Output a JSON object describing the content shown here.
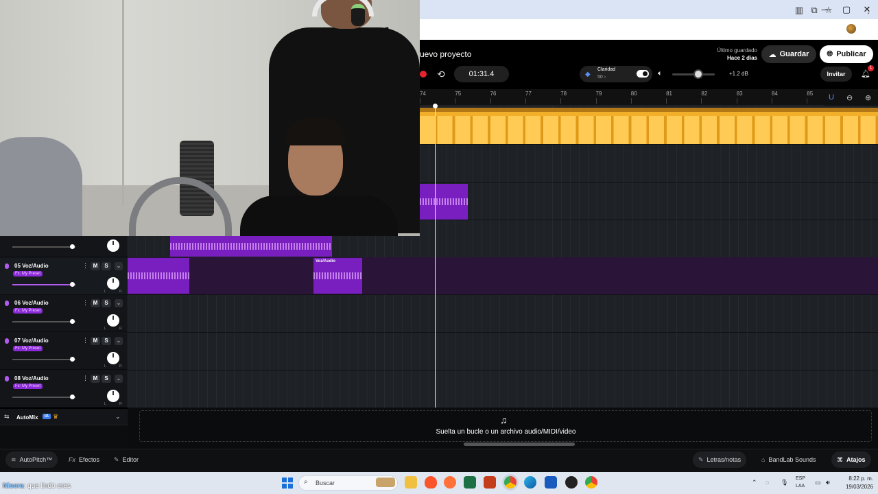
{
  "browser": {
    "window_controls": {
      "minimize": "—",
      "maximize": "▢",
      "close": "✕"
    },
    "toolbar_icons": [
      "sidebar-icon",
      "install-icon",
      "star-icon",
      "profile-avatar",
      "kebab-menu-icon"
    ]
  },
  "header": {
    "project_title": "uevo proyecto",
    "last_saved_label": "Último guardado",
    "last_saved_value": "Hace 2 días",
    "save_label": "Guardar",
    "publish_label": "Publicar"
  },
  "transport": {
    "time": "01:31.4",
    "clarity_label": "Claridad",
    "clarity_value": "50 ›",
    "clarity_enabled": true,
    "volume_level": 0.62,
    "gain": "+1.2 dB",
    "invite_label": "Invitar",
    "notifications_count": "1"
  },
  "ruler": {
    "bars": [
      "74",
      "75",
      "76",
      "77",
      "78",
      "79",
      "80",
      "81",
      "82",
      "83",
      "84",
      "85"
    ]
  },
  "tracks": [
    {
      "name": "05 Voz/Audio",
      "fx": "Fx: My Preset",
      "mute": "M",
      "solo": "S",
      "pan_l": "L",
      "pan_r": "R"
    },
    {
      "name": "06 Voz/Audio",
      "fx": "Fx: My Preset",
      "mute": "M",
      "solo": "S",
      "pan_l": "L",
      "pan_r": "R"
    },
    {
      "name": "07 Voz/Audio",
      "fx": "Fx: My Preset",
      "mute": "M",
      "solo": "S",
      "pan_l": "L",
      "pan_r": "R"
    },
    {
      "name": "08 Voz/Audio",
      "fx": "Fx: My Preset",
      "mute": "M",
      "solo": "S",
      "pan_l": "L",
      "pan_r": "R"
    }
  ],
  "clips": {
    "voz_audio_label": "Voz/Audio"
  },
  "automix": {
    "label": "AutoMix",
    "badge": "IA"
  },
  "drop_zone": {
    "text": "Suelta un bucle o un archivo audio/MIDI/video"
  },
  "bottom_toolbar": {
    "autopitch": "AutoPitch™",
    "effects": "Efectos",
    "editor": "Editor",
    "lyrics": "Letras/notas",
    "sounds": "BandLab Sounds",
    "shortcuts": "Atajos"
  },
  "overlay_chat": {
    "user": "Nisera",
    "message": ": que lindo eres"
  },
  "taskbar": {
    "search_placeholder": "Buscar",
    "language_top": "ESP",
    "language_bottom": "LAA",
    "time": "8:22 p. m.",
    "date": "19/03/2026"
  },
  "colors": {
    "accent_purple": "#7a1fbf",
    "clip_yellow": "#f2b02a",
    "record_red": "#e8232f",
    "timeline_bg": "#1e2226"
  }
}
